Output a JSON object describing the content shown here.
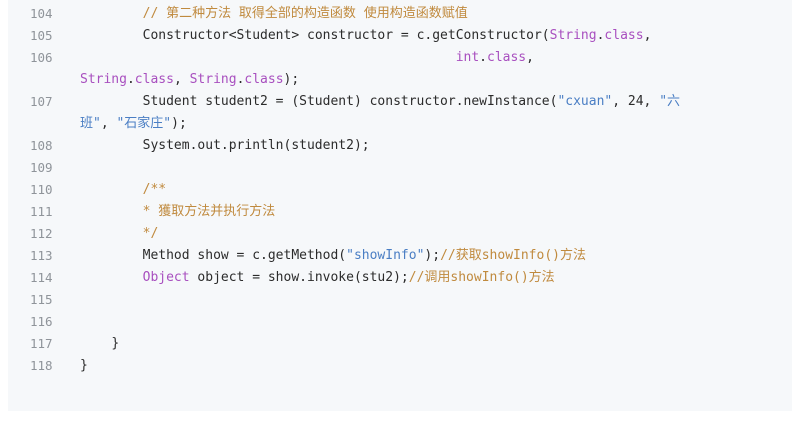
{
  "colors": {
    "background": "#f6f8fa",
    "line_number": "#8f949a",
    "plain": "#2b2b2b",
    "comment": "#c08a3e",
    "type": "#a84fbf",
    "string": "#4a7ec4"
  },
  "code": {
    "lines": [
      {
        "n": "104",
        "indent": "        ",
        "tokens": [
          {
            "t": "comment",
            "v": "// 第二种方法 取得全部的构造函数 使用构造函数赋值"
          }
        ]
      },
      {
        "n": "105",
        "indent": "        ",
        "tokens": [
          {
            "t": "plain",
            "v": "Constructor<"
          },
          {
            "t": "plain",
            "v": "Student"
          },
          {
            "t": "plain",
            "v": "> constructor = c.getConstructor("
          },
          {
            "t": "type",
            "v": "String"
          },
          {
            "t": "plain",
            "v": "."
          },
          {
            "t": "keyword",
            "v": "class"
          },
          {
            "t": "plain",
            "v": ","
          }
        ]
      },
      {
        "n": "106",
        "indent": "                                                ",
        "tokens": [
          {
            "t": "keyword",
            "v": "int"
          },
          {
            "t": "plain",
            "v": "."
          },
          {
            "t": "keyword",
            "v": "class"
          },
          {
            "t": "plain",
            "v": ","
          }
        ]
      },
      {
        "n": "",
        "indent": "",
        "tokens": [
          {
            "t": "type",
            "v": "String"
          },
          {
            "t": "plain",
            "v": "."
          },
          {
            "t": "keyword",
            "v": "class"
          },
          {
            "t": "plain",
            "v": ", "
          },
          {
            "t": "type",
            "v": "String"
          },
          {
            "t": "plain",
            "v": "."
          },
          {
            "t": "keyword",
            "v": "class"
          },
          {
            "t": "plain",
            "v": ");"
          }
        ]
      },
      {
        "n": "107",
        "indent": "        ",
        "tokens": [
          {
            "t": "plain",
            "v": "Student student2 = (Student) constructor.newInstance("
          },
          {
            "t": "string",
            "v": "\"cxuan\""
          },
          {
            "t": "plain",
            "v": ", 24, "
          },
          {
            "t": "string",
            "v": "\"六"
          }
        ]
      },
      {
        "n": "",
        "indent": "",
        "tokens": [
          {
            "t": "string",
            "v": "班\""
          },
          {
            "t": "plain",
            "v": ", "
          },
          {
            "t": "string",
            "v": "\"石家庄\""
          },
          {
            "t": "plain",
            "v": ");"
          }
        ]
      },
      {
        "n": "108",
        "indent": "        ",
        "tokens": [
          {
            "t": "plain",
            "v": "System.out.println(student2);"
          }
        ]
      },
      {
        "n": "109",
        "indent": "",
        "tokens": []
      },
      {
        "n": "110",
        "indent": "        ",
        "tokens": [
          {
            "t": "comment",
            "v": "/**"
          }
        ]
      },
      {
        "n": "111",
        "indent": "        ",
        "tokens": [
          {
            "t": "comment",
            "v": "* 獲取方法并执行方法"
          }
        ]
      },
      {
        "n": "112",
        "indent": "        ",
        "tokens": [
          {
            "t": "comment",
            "v": "*/"
          }
        ]
      },
      {
        "n": "113",
        "indent": "        ",
        "tokens": [
          {
            "t": "plain",
            "v": "Method show = c.getMethod("
          },
          {
            "t": "string",
            "v": "\"showInfo\""
          },
          {
            "t": "plain",
            "v": ");"
          },
          {
            "t": "comment",
            "v": "//获取showInfo()方法"
          }
        ]
      },
      {
        "n": "114",
        "indent": "        ",
        "tokens": [
          {
            "t": "type",
            "v": "Object"
          },
          {
            "t": "plain",
            "v": " object = show.invoke(stu2);"
          },
          {
            "t": "comment",
            "v": "//调用showInfo()方法"
          }
        ]
      },
      {
        "n": "115",
        "indent": "",
        "tokens": []
      },
      {
        "n": "116",
        "indent": "",
        "tokens": []
      },
      {
        "n": "117",
        "indent": "    ",
        "tokens": [
          {
            "t": "plain",
            "v": "}"
          }
        ]
      },
      {
        "n": "118",
        "indent": "",
        "tokens": [
          {
            "t": "plain",
            "v": "}"
          }
        ]
      }
    ]
  }
}
